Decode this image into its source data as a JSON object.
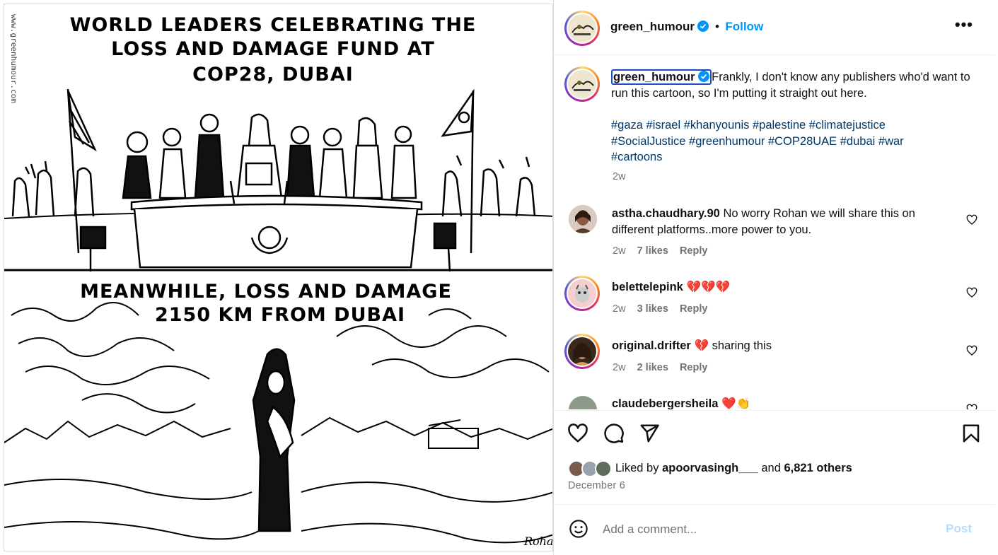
{
  "image": {
    "watermark": "www.greenhumour.com",
    "top_caption": [
      "WORLD LEADERS CELEBRATING THE",
      "LOSS AND DAMAGE FUND AT",
      "COP28, DUBAI"
    ],
    "bottom_caption": [
      "MEANWHILE, LOSS AND DAMAGE",
      "2150 KM FROM DUBAI"
    ],
    "signature": "Rohan"
  },
  "header": {
    "username": "green_humour",
    "separator": "•",
    "follow_label": "Follow",
    "more_label": "•••"
  },
  "caption": {
    "username": "green_humour",
    "text": "Frankly, I don't know any publishers who'd want to run this cartoon, so I'm putting it straight out here.",
    "hashtags_line1": "#gaza #israel #khanyounis #palestine #climatejustice",
    "hashtags_line2": "#SocialJustice #greenhumour #COP28UAE #dubai #war",
    "hashtags_line3": "#cartoons",
    "time": "2w"
  },
  "comments": [
    {
      "username": "astha.chaudhary.90",
      "text": "No worry Rohan we will share this on",
      "text2": "different platforms..more power to you.",
      "time": "2w",
      "likes": "7 likes",
      "reply": "Reply"
    },
    {
      "username": "belettelepink",
      "text": "💔💔💔",
      "time": "2w",
      "likes": "3 likes",
      "reply": "Reply"
    },
    {
      "username": "original.drifter",
      "text": "💔 sharing this",
      "time": "2w",
      "likes": "2 likes",
      "reply": "Reply"
    },
    {
      "username": "claudebergersheila",
      "text": "❤️👏",
      "time": "",
      "likes": "",
      "reply": ""
    }
  ],
  "likes": {
    "prefix": "Liked by",
    "user": "apoorvasingh___",
    "and": "and",
    "others": "6,821 others"
  },
  "date": "December 6",
  "add_comment": {
    "placeholder": "Add a comment...",
    "post_label": "Post"
  },
  "colors": {
    "link_blue": "#0095f6",
    "hashtag": "#00376b",
    "muted": "#737373",
    "focus_outline": "#1a4fc4"
  }
}
